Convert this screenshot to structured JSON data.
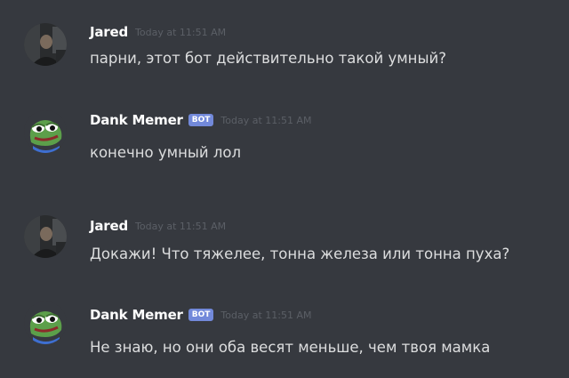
{
  "messages": [
    {
      "author": "Jared",
      "timestamp": "Today at 11:51 AM",
      "text": "парни, этот бот действительно такой умный?",
      "avatar": "user-photo-avatar"
    },
    {
      "author": "Dank Memer",
      "badge": "BOT",
      "timestamp": "Today at 11:51 AM",
      "text": "конечно умный лол",
      "avatar": "pepe-frog-avatar"
    },
    {
      "author": "Jared",
      "timestamp": "Today at 11:51 AM",
      "text": "Докажи! Что тяжелее, тонна железа или тонна пуха?",
      "avatar": "user-photo-avatar"
    },
    {
      "author": "Dank Memer",
      "badge": "BOT",
      "timestamp": "Today at 11:51 AM",
      "text": "Не знаю, но они оба весят меньше, чем твоя мамка",
      "avatar": "pepe-frog-avatar"
    }
  ],
  "colors": {
    "background": "#36393f",
    "username": "#ffffff",
    "message_text": "#dcddde",
    "timestamp": "#5b5f66",
    "bot_badge": "#7289da"
  }
}
